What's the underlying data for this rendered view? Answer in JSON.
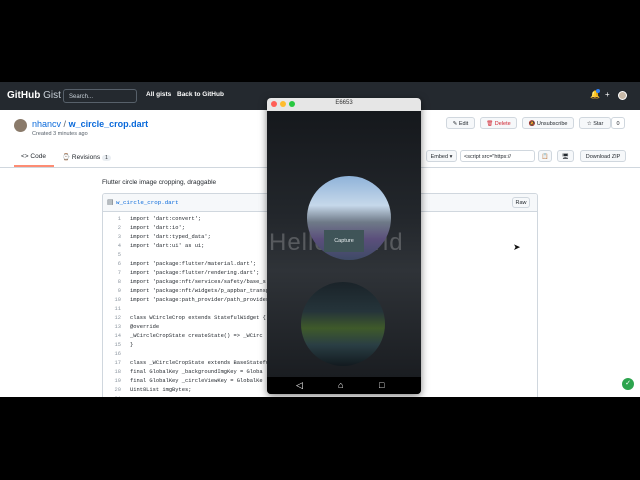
{
  "header": {
    "logo_main": "GitHub",
    "logo_sub": "Gist",
    "search_placeholder": "Search...",
    "nav": [
      "All gists",
      "Back to GitHub"
    ]
  },
  "gist": {
    "owner": "nhancv",
    "separator": "/",
    "filename_title": "w_circle_crop.dart",
    "created": "Created 3 minutes ago",
    "buttons": {
      "edit": "Edit",
      "delete": "Delete",
      "unsubscribe": "Unsubscribe",
      "star": "Star"
    },
    "star_count": "0",
    "tabs": {
      "code": "Code",
      "revisions": "Revisions",
      "revisions_count": "1"
    },
    "embed": "Embed",
    "embed_value": "<script src=\"https://",
    "download": "Download ZIP",
    "description": "Flutter circle image cropping, draggable"
  },
  "file": {
    "name": "w_circle_crop.dart",
    "raw": "Raw",
    "lines": [
      {
        "n": "1",
        "t": "import 'dart:convert';"
      },
      {
        "n": "2",
        "t": "import 'dart:io';"
      },
      {
        "n": "3",
        "t": "import 'dart:typed_data';"
      },
      {
        "n": "4",
        "t": "import 'dart:ui' as ui;"
      },
      {
        "n": "5",
        "t": ""
      },
      {
        "n": "6",
        "t": "import 'package:flutter/material.dart';"
      },
      {
        "n": "7",
        "t": "import 'package:flutter/rendering.dart';"
      },
      {
        "n": "8",
        "t": "import 'package:nft/services/safety/base_s"
      },
      {
        "n": "9",
        "t": "import 'package:nft/widgets/p_appbar_transp"
      },
      {
        "n": "10",
        "t": "import 'package:path_provider/path_provider"
      },
      {
        "n": "11",
        "t": ""
      },
      {
        "n": "12",
        "t": "class WCircleCrop extends StatefulWidget {"
      },
      {
        "n": "13",
        "t": "  @override"
      },
      {
        "n": "14",
        "t": "  _WCircleCropState createState() => _WCirc"
      },
      {
        "n": "15",
        "t": "}"
      },
      {
        "n": "16",
        "t": ""
      },
      {
        "n": "17",
        "t": "class _WCircleCropState extends BaseStatefu"
      },
      {
        "n": "18",
        "t": "  final GlobalKey _backgroundImgKey = Globa"
      },
      {
        "n": "19",
        "t": "  final GlobalKey _circleViewKey = GlobalKe"
      },
      {
        "n": "20",
        "t": "  Uint8List imgBytes;"
      },
      {
        "n": "21",
        "t": ""
      }
    ]
  },
  "emulator": {
    "title": "E6653",
    "bg_text": "Hello World",
    "capture": "Capture",
    "nav_icons": [
      "back-icon",
      "home-icon",
      "recents-icon"
    ]
  }
}
